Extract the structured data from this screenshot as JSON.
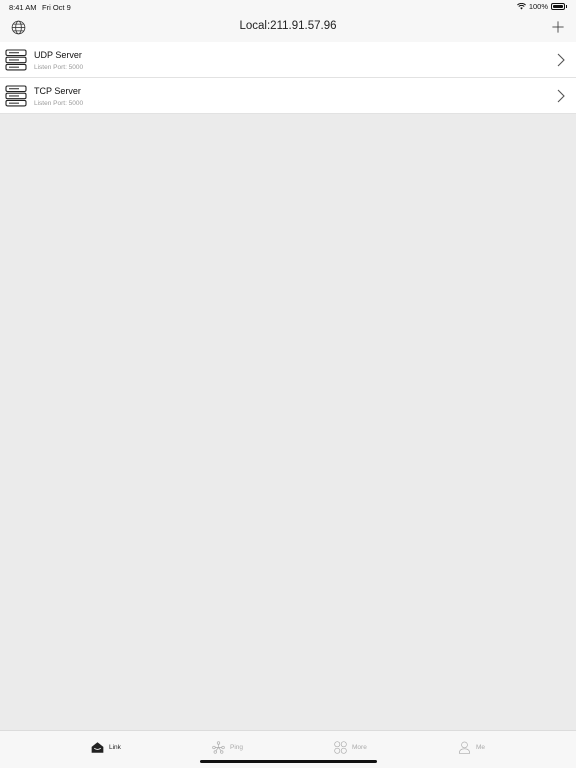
{
  "status_bar": {
    "time": "8:41 AM",
    "date": "Fri Oct 9",
    "battery_percent": "100%",
    "battery_level": 1.0
  },
  "nav": {
    "title": "Local:211.91.57.96",
    "left_icon": "globe-icon",
    "right_icon": "plus-icon"
  },
  "servers": [
    {
      "title": "UDP Server",
      "subtitle": "Listen Port: 5000",
      "icon": "server-stack-icon"
    },
    {
      "title": "TCP Server",
      "subtitle": "Listen Port: 5000",
      "icon": "server-stack-icon"
    }
  ],
  "tabs": [
    {
      "label": "Link",
      "icon": "home-icon",
      "active": true
    },
    {
      "label": "Ping",
      "icon": "network-icon",
      "active": false
    },
    {
      "label": "More",
      "icon": "grid-icon",
      "active": false
    },
    {
      "label": "Me",
      "icon": "person-icon",
      "active": false
    }
  ],
  "colors": {
    "background": "#ebebeb",
    "bar_background": "#f7f7f7",
    "row_background": "#ffffff",
    "subtitle_gray": "#9a9a9a",
    "inactive_tab": "#aaaaaa"
  }
}
